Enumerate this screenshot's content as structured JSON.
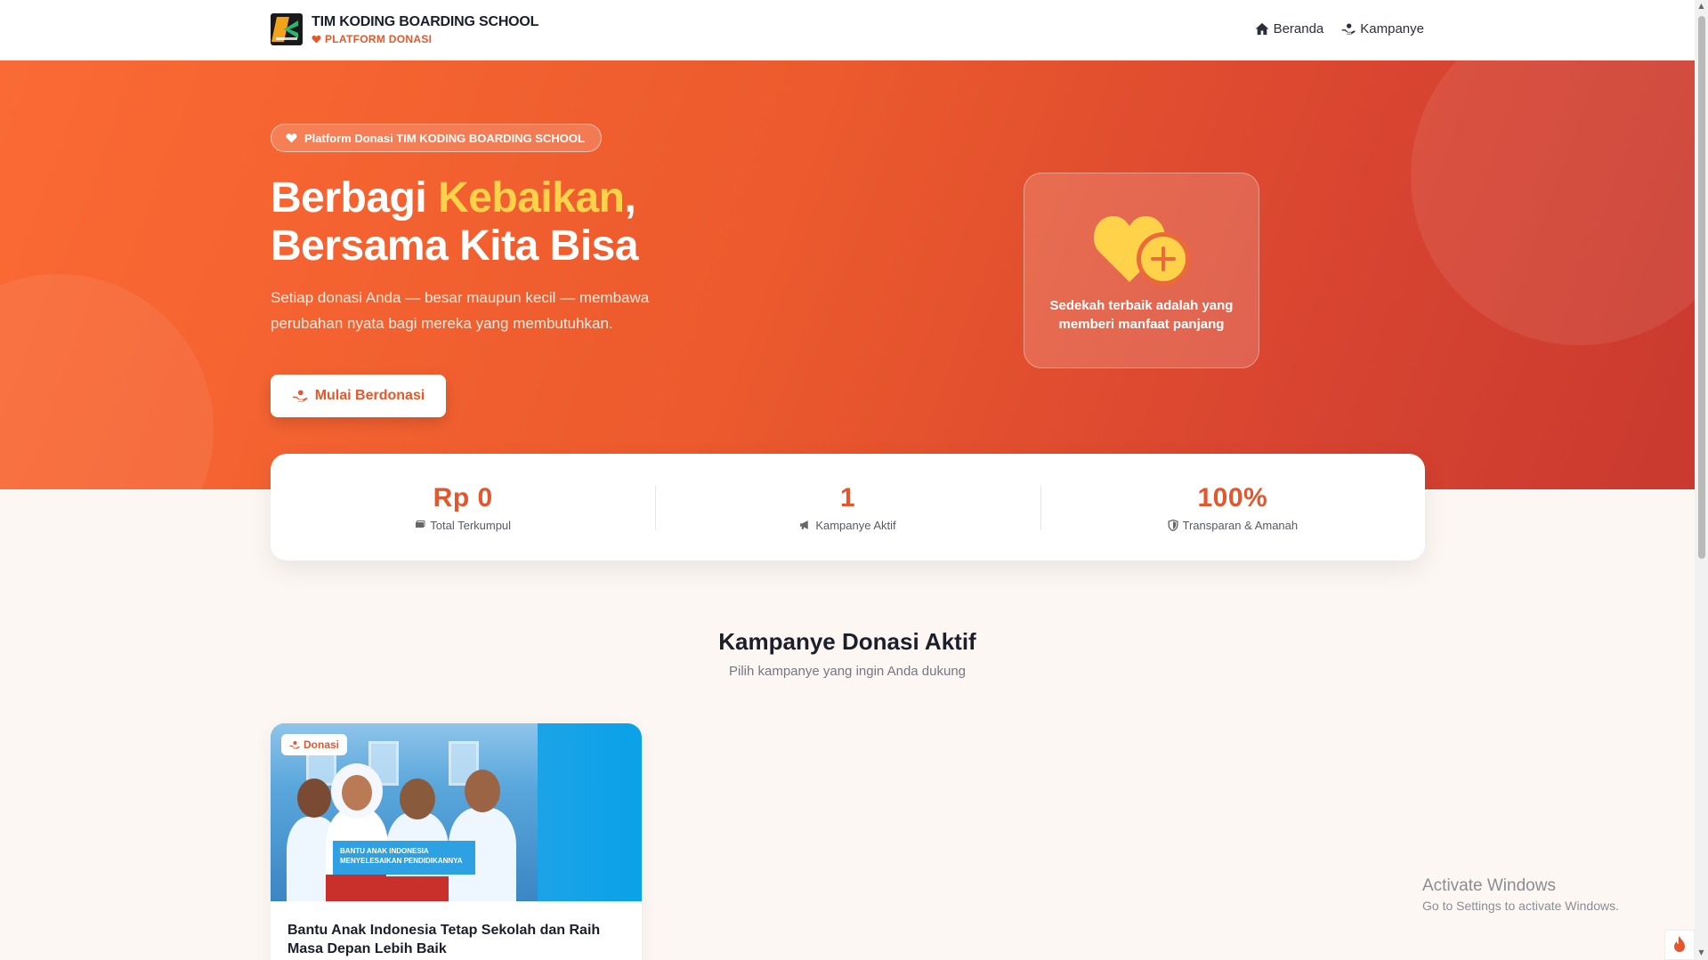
{
  "nav": {
    "brand_title": "TIM KODING BOARDING SCHOOL",
    "brand_subtitle": "PLATFORM DONASI",
    "links": [
      {
        "label": "Beranda",
        "icon": "home-icon"
      },
      {
        "label": "Kampanye",
        "icon": "hand-heart-icon"
      }
    ]
  },
  "hero": {
    "pill_text": "Platform Donasi TIM KODING BOARDING SCHOOL",
    "headline_part1": "Berbagi ",
    "headline_highlight": "Kebaikan",
    "headline_part2": ",",
    "headline_line2": "Bersama Kita Bisa",
    "lead": "Setiap donasi Anda — besar maupun kecil — membawa perubahan nyata bagi mereka yang membutuhkan.",
    "cta_label": "Mulai Berdonasi",
    "quote": "Sedekah terbaik adalah yang memberi manfaat panjang"
  },
  "stats": [
    {
      "value": "Rp 0",
      "label": "Total Terkumpul",
      "icon": "money-icon"
    },
    {
      "value": "1",
      "label": "Kampanye Aktif",
      "icon": "megaphone-icon"
    },
    {
      "value": "100%",
      "label": "Transparan & Amanah",
      "icon": "shield-icon"
    }
  ],
  "section": {
    "title": "Kampanye Donasi Aktif",
    "subtitle": "Pilih kampanye yang ingin Anda dukung"
  },
  "campaigns": [
    {
      "badge": "Donasi",
      "image_banner_line1": "BANTU ANAK INDONESIA",
      "image_banner_line2": "MENYELESAIKAN PENDIDIKANNYA",
      "title": "Bantu Anak Indonesia Tetap Sekolah dan Raih Masa Depan Lebih Baik"
    }
  ],
  "watermark": {
    "line1": "Activate Windows",
    "line2": "Go to Settings to activate Windows."
  },
  "colors": {
    "accent": "#e8572a",
    "highlight": "#ffd24a",
    "hero_start": "#fb6a34",
    "hero_end": "#c9392f"
  }
}
